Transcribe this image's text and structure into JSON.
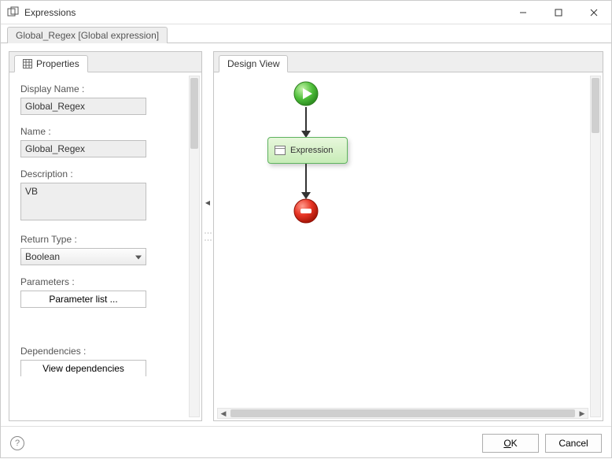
{
  "window": {
    "title": "Expressions"
  },
  "outer_tab": "Global_Regex [Global expression]",
  "left_panel": {
    "tab_label": "Properties",
    "display_name_label": "Display Name :",
    "display_name_value": "Global_Regex",
    "name_label": "Name :",
    "name_value": "Global_Regex",
    "description_label": "Description :",
    "description_value": "VB",
    "return_type_label": "Return Type :",
    "return_type_value": "Boolean",
    "parameters_label": "Parameters :",
    "parameters_button": "Parameter list ...",
    "dependencies_label": "Dependencies :",
    "dependencies_button": "View dependencies"
  },
  "right_panel": {
    "tab_label": "Design View",
    "start_node": "start",
    "expression_node_label": "Expression",
    "end_node": "stop"
  },
  "footer": {
    "ok": "OK",
    "cancel": "Cancel"
  }
}
